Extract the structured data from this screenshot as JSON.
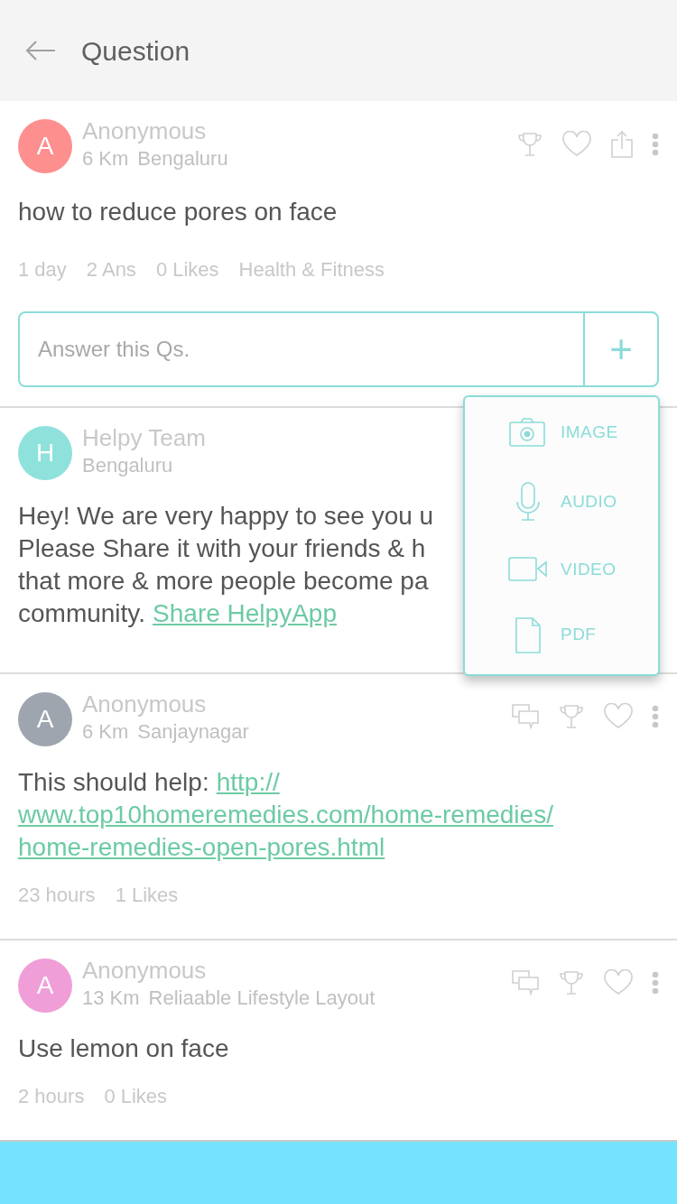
{
  "header": {
    "title": "Question"
  },
  "question": {
    "kind": "question",
    "avatar_letter": "A",
    "color": "#fd8f8f",
    "author": "Anonymous",
    "distance": "6 Km",
    "place": "Bengaluru",
    "text": "how to reduce pores on face",
    "meta": [
      "1 day",
      "2 Ans",
      "0 Likes",
      "Health & Fitness"
    ]
  },
  "answer_field": {
    "placeholder": "Answer this Qs.",
    "add": "+"
  },
  "answers": [
    {
      "kind": "team",
      "avatar_letter": "H",
      "color": "#8fe2dc",
      "author": "Helpy Team",
      "place": "Bengaluru",
      "lines": [
        "Hey! We are very happy to see you u",
        "Please Share it with your friends & h",
        "that more & more people become pa"
      ],
      "last_line": "community.",
      "link": "Share HelpyApp"
    },
    {
      "kind": "answer",
      "avatar_letter": "A",
      "color": "#9ea5ae",
      "author": "Anonymous",
      "distance": "6 Km",
      "place": "Sanjaynagar",
      "lead": "This should help:",
      "link_lines": [
        "http://",
        "www.top10homeremedies.com/home-remedies/",
        "home-remedies-open-pores.html"
      ],
      "meta": [
        "23 hours",
        "1 Likes"
      ]
    },
    {
      "kind": "answer",
      "avatar_letter": "A",
      "color": "#f09ed7",
      "author": "Anonymous",
      "distance": "13 Km",
      "place": "Reliaable Lifestyle Layout",
      "text": "Use lemon on face",
      "meta": [
        "2 hours",
        "0 Likes"
      ]
    }
  ],
  "attach_menu": [
    {
      "kind": "image",
      "label": "IMAGE"
    },
    {
      "kind": "audio",
      "label": "AUDIO"
    },
    {
      "kind": "video",
      "label": "VIDEO"
    },
    {
      "kind": "pdf",
      "label": "PDF"
    }
  ]
}
